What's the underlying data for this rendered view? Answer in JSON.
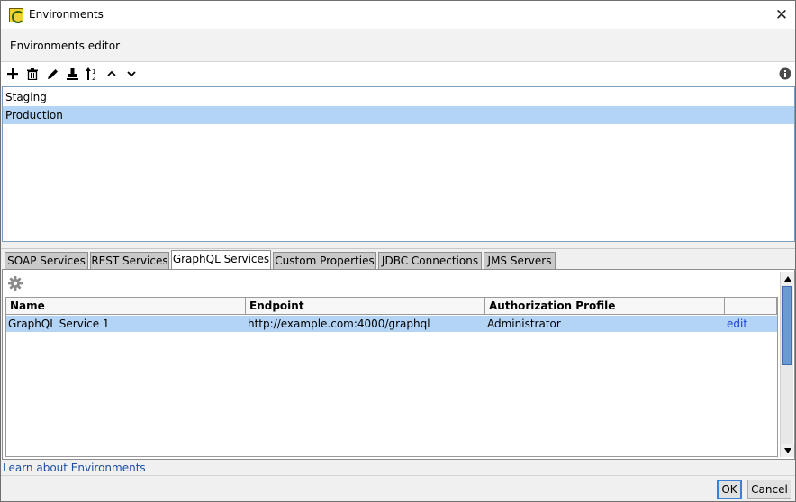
{
  "window": {
    "title": "Environments",
    "close_glyph": "✕"
  },
  "header": {
    "title": "Environments editor"
  },
  "toolbar": {
    "icons": [
      "add-icon",
      "delete-icon",
      "rename-icon",
      "clone-icon",
      "sort-icon",
      "move-up-icon",
      "move-down-icon",
      "info-icon"
    ]
  },
  "environments": {
    "items": [
      {
        "label": "Staging",
        "selected": false
      },
      {
        "label": "Production",
        "selected": true
      }
    ]
  },
  "tabs": [
    {
      "label": "SOAP Services",
      "active": false
    },
    {
      "label": "REST Services",
      "active": false
    },
    {
      "label": "GraphQL Services",
      "active": true
    },
    {
      "label": "Custom Properties",
      "active": false
    },
    {
      "label": "JDBC Connections",
      "active": false
    },
    {
      "label": "JMS Servers",
      "active": false
    }
  ],
  "table": {
    "columns": [
      "Name",
      "Endpoint",
      "Authorization Profile",
      ""
    ],
    "rows": [
      {
        "name": "GraphQL Service 1",
        "endpoint": "http://example.com:4000/graphql",
        "auth_profile": "Administrator",
        "action": "edit"
      }
    ]
  },
  "footer": {
    "learn_link": "Learn about Environments",
    "ok_label": "OK",
    "cancel_label": "Cancel"
  },
  "colors": {
    "selection": "#b3d4f5",
    "link": "#1a3fd6",
    "scroll_thumb": "#6b9ad3"
  }
}
